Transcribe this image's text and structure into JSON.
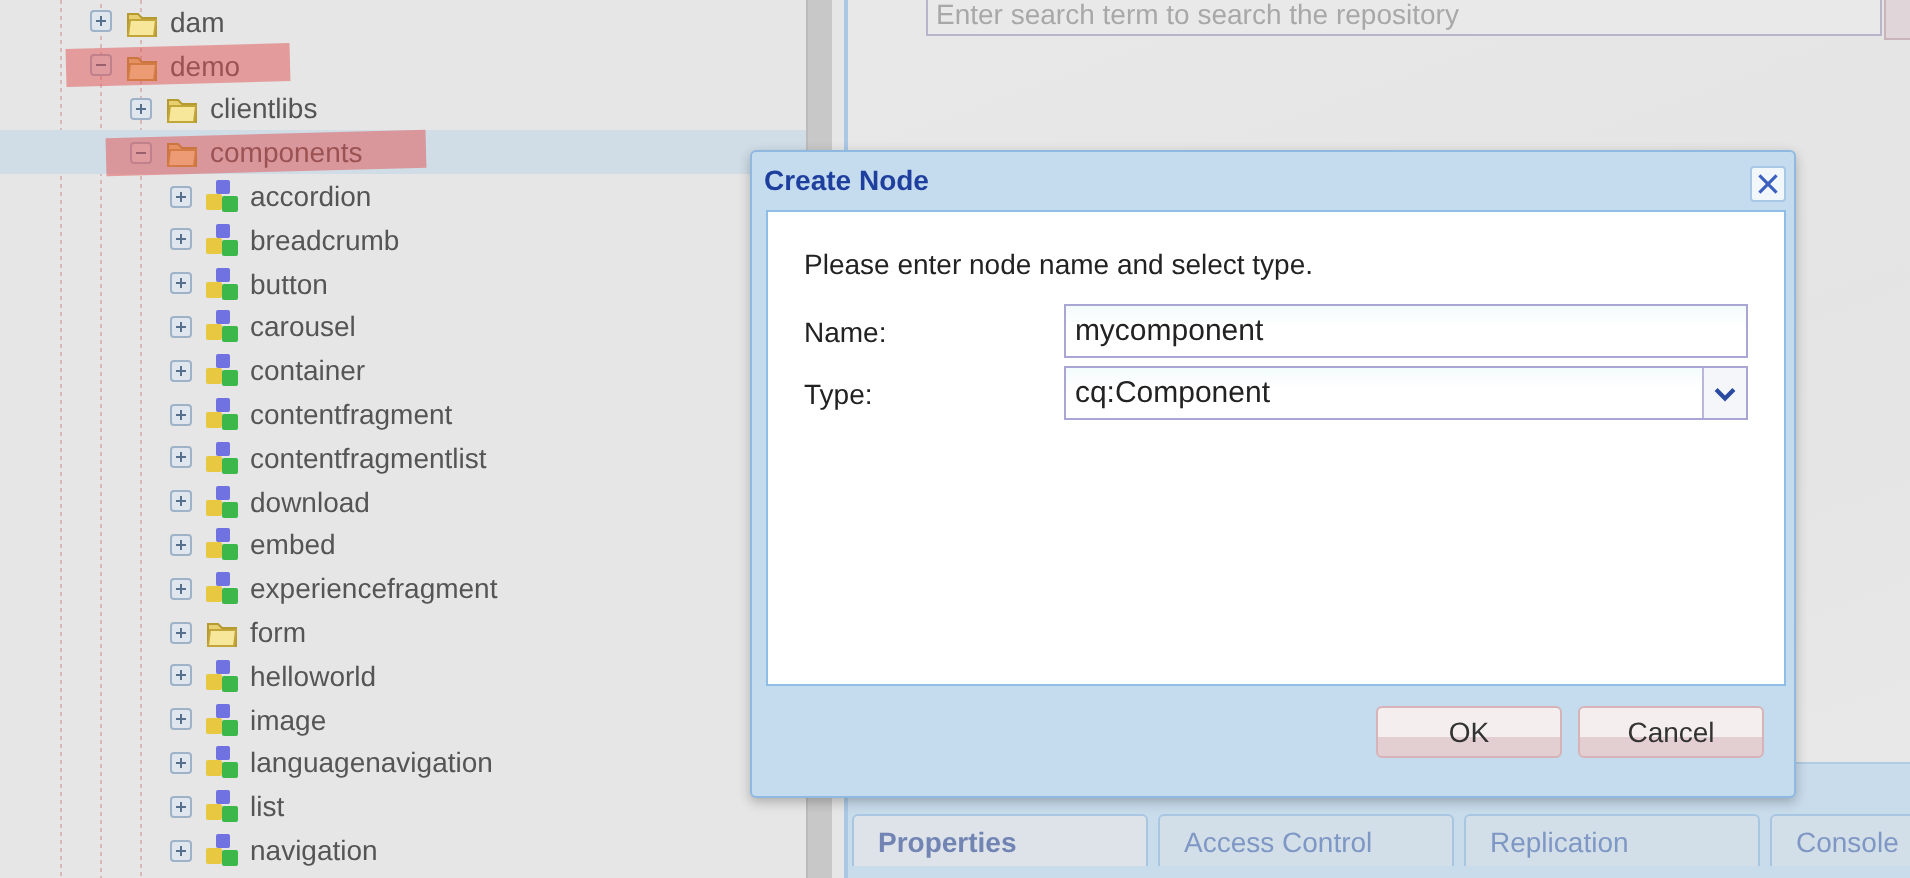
{
  "tree": [
    {
      "label": "dam",
      "kind": "folder",
      "expanded": false,
      "selected": false,
      "highlighted": false
    },
    {
      "label": "demo",
      "kind": "folder",
      "expanded": true,
      "selected": false,
      "highlighted": true,
      "children": [
        {
          "label": "clientlibs",
          "kind": "folder",
          "expanded": false,
          "selected": false,
          "highlighted": false
        },
        {
          "label": "components",
          "kind": "folder",
          "expanded": true,
          "selected": true,
          "highlighted": true,
          "children": [
            {
              "label": "accordion",
              "kind": "component",
              "expanded": false,
              "selected": false,
              "highlighted": false
            },
            {
              "label": "breadcrumb",
              "kind": "component",
              "expanded": false,
              "selected": false,
              "highlighted": false
            },
            {
              "label": "button",
              "kind": "component",
              "expanded": false,
              "selected": false,
              "highlighted": false
            },
            {
              "label": "carousel",
              "kind": "component",
              "expanded": false,
              "selected": false,
              "highlighted": false
            },
            {
              "label": "container",
              "kind": "component",
              "expanded": false,
              "selected": false,
              "highlighted": false
            },
            {
              "label": "contentfragment",
              "kind": "component",
              "expanded": false,
              "selected": false,
              "highlighted": false
            },
            {
              "label": "contentfragmentlist",
              "kind": "component",
              "expanded": false,
              "selected": false,
              "highlighted": false
            },
            {
              "label": "download",
              "kind": "component",
              "expanded": false,
              "selected": false,
              "highlighted": false
            },
            {
              "label": "embed",
              "kind": "component",
              "expanded": false,
              "selected": false,
              "highlighted": false
            },
            {
              "label": "experiencefragment",
              "kind": "component",
              "expanded": false,
              "selected": false,
              "highlighted": false
            },
            {
              "label": "form",
              "kind": "folder",
              "expanded": false,
              "selected": false,
              "highlighted": false
            },
            {
              "label": "helloworld",
              "kind": "component",
              "expanded": false,
              "selected": false,
              "highlighted": false
            },
            {
              "label": "image",
              "kind": "component",
              "expanded": false,
              "selected": false,
              "highlighted": false
            },
            {
              "label": "languagenavigation",
              "kind": "component",
              "expanded": false,
              "selected": false,
              "highlighted": false
            },
            {
              "label": "list",
              "kind": "component",
              "expanded": false,
              "selected": false,
              "highlighted": false
            },
            {
              "label": "navigation",
              "kind": "component",
              "expanded": false,
              "selected": false,
              "highlighted": false
            }
          ]
        }
      ]
    }
  ],
  "search": {
    "placeholder": "Enter search term to search the repository"
  },
  "dialog": {
    "title": "Create Node",
    "message": "Please enter node name and select type.",
    "fields": [
      {
        "label": "Name:",
        "kind": "text",
        "value": "mycomponent"
      },
      {
        "label": "Type:",
        "kind": "select",
        "value": "cq:Component"
      }
    ],
    "buttons": [
      "OK",
      "Cancel"
    ]
  },
  "tabs": [
    {
      "label": "Properties",
      "selected": true
    },
    {
      "label": "Access Control",
      "selected": false
    },
    {
      "label": "Replication",
      "selected": false
    },
    {
      "label": "Console",
      "selected": false
    }
  ]
}
